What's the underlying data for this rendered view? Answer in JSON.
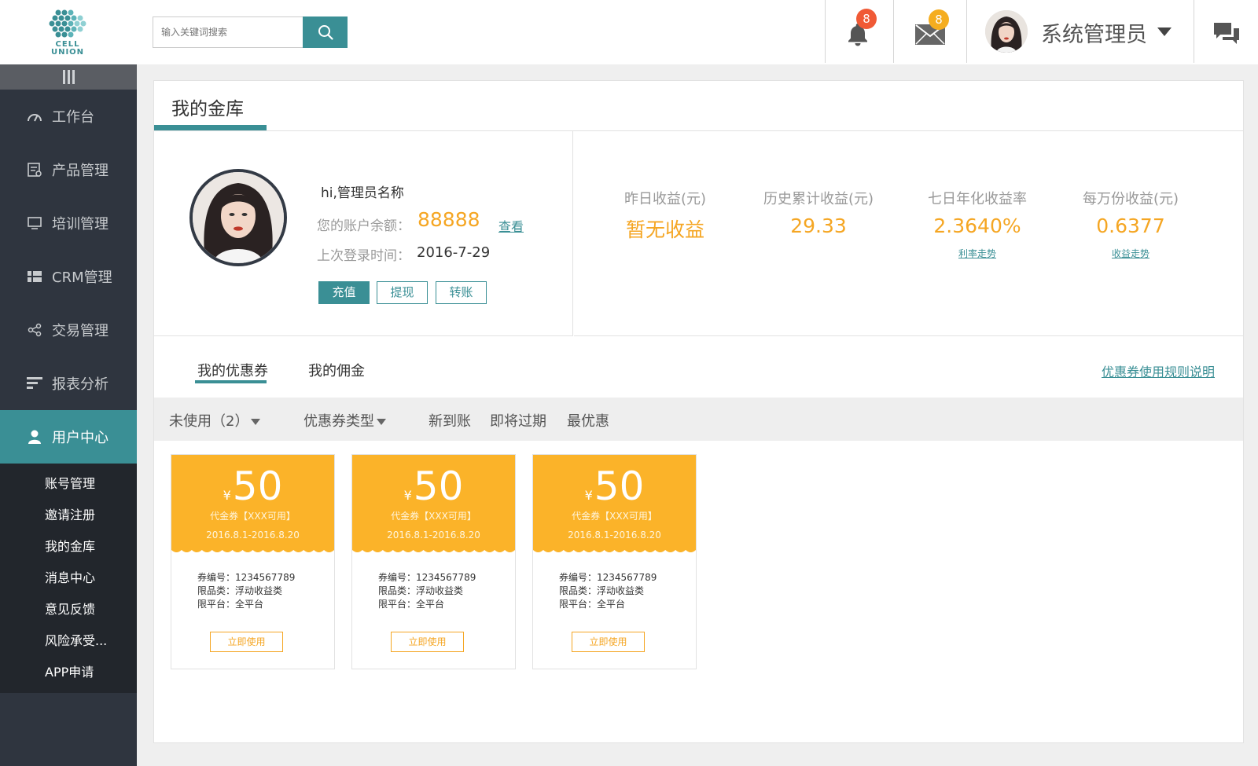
{
  "header": {
    "logo_line1": "CELL",
    "logo_line2": "UNION",
    "search_placeholder": "输入关键词搜索",
    "notifications_count": "8",
    "messages_count": "8",
    "user_name": "系统管理员",
    "accent": "#3a8f95"
  },
  "sidebar": {
    "items": [
      {
        "label": "工作台",
        "icon": "dashboard-gauge-icon"
      },
      {
        "label": "产品管理",
        "icon": "product-list-icon"
      },
      {
        "label": "培训管理",
        "icon": "monitor-icon"
      },
      {
        "label": "CRM管理",
        "icon": "grid-icon"
      },
      {
        "label": "交易管理",
        "icon": "share-nodes-icon"
      },
      {
        "label": "报表分析",
        "icon": "report-lines-icon"
      },
      {
        "label": "用户中心",
        "icon": "user-icon"
      }
    ],
    "sub_items": [
      "账号管理",
      "邀请注册",
      "我的金库",
      "消息中心",
      "意见反馈",
      "风险承受...",
      "APP申请"
    ]
  },
  "main": {
    "title": "我的金库",
    "account": {
      "greeting": "hi,管理员名称",
      "balance_label": "您的账户余额：",
      "balance_value": "88888",
      "view_link": "查看",
      "last_login_label": "上次登录时间：",
      "last_login_value": "2016-7-29",
      "btn_recharge": "充值",
      "btn_withdraw": "提现",
      "btn_transfer": "转账"
    },
    "stats": [
      {
        "label": "昨日收益(元)",
        "value": "暂无收益",
        "link": ""
      },
      {
        "label": "历史累计收益(元)",
        "value": "29.33",
        "link": ""
      },
      {
        "label": "七日年化收益率",
        "value": "2.3640%",
        "link": "利率走势"
      },
      {
        "label": "每万份收益(元)",
        "value": "0.6377",
        "link": "收益走势"
      }
    ],
    "tabs": [
      "我的优惠券",
      "我的佣金"
    ],
    "rules_link": "优惠券使用规则说明",
    "filters": {
      "unused": "未使用（2）",
      "type": "优惠券类型",
      "new": "新到账",
      "expiring": "即将过期",
      "best": "最优惠"
    },
    "coupons": [
      {
        "currency": "¥",
        "amount": "50",
        "type": "代金券【XXX可用】",
        "date": "2016.8.1-2016.8.20",
        "code": "券编号：1234567789",
        "category": "限品类：浮动收益类",
        "platform": "限平台：全平台",
        "button": "立即使用"
      },
      {
        "currency": "¥",
        "amount": "50",
        "type": "代金券【XXX可用】",
        "date": "2016.8.1-2016.8.20",
        "code": "券编号：1234567789",
        "category": "限品类：浮动收益类",
        "platform": "限平台：全平台",
        "button": "立即使用"
      },
      {
        "currency": "¥",
        "amount": "50",
        "type": "代金券【XXX可用】",
        "date": "2016.8.1-2016.8.20",
        "code": "券编号：1234567789",
        "category": "限品类：浮动收益类",
        "platform": "限平台：全平台",
        "button": "立即使用"
      }
    ]
  }
}
